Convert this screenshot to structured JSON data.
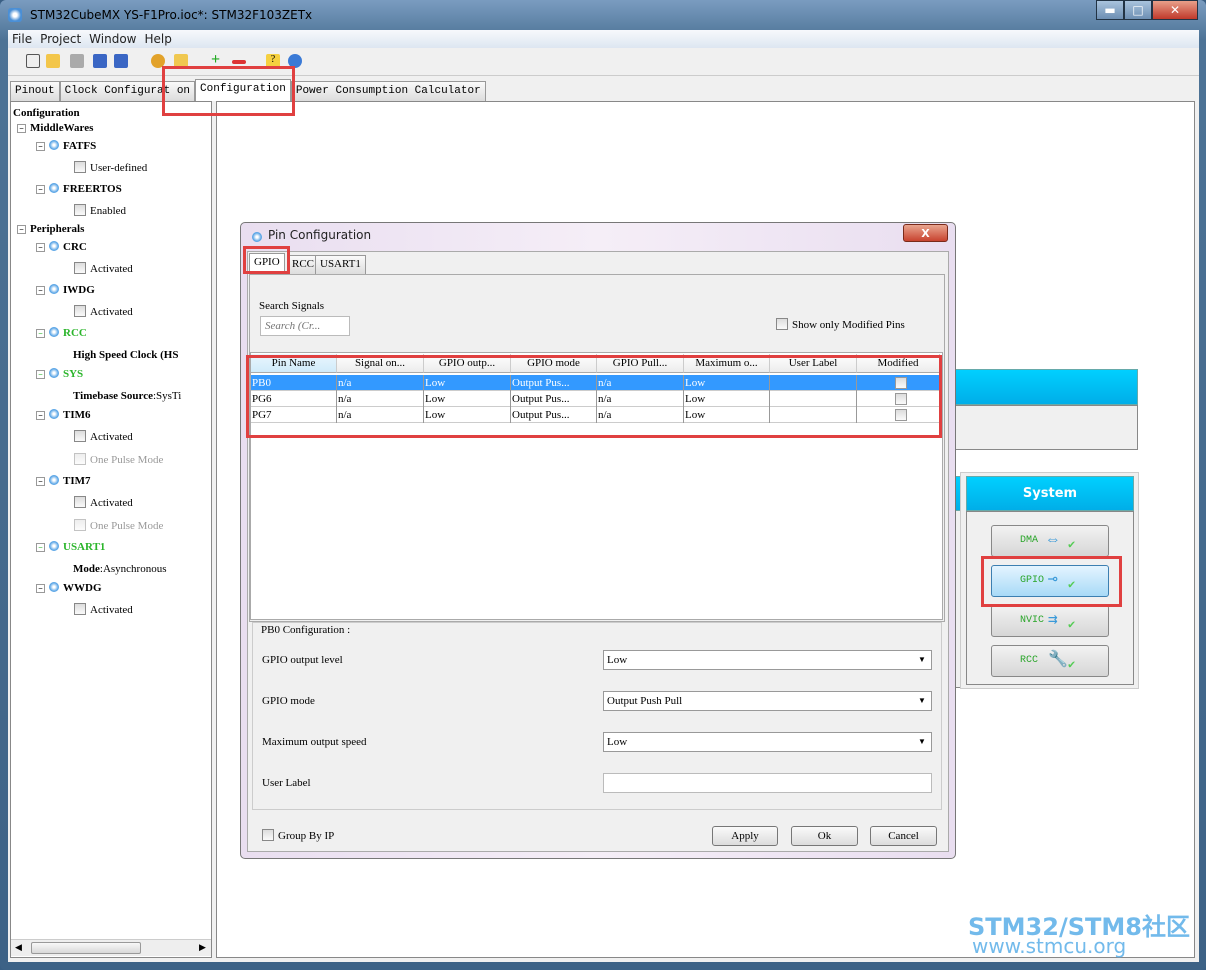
{
  "window": {
    "title": "STM32CubeMX YS-F1Pro.ioc*: STM32F103ZETx",
    "minimize": "▬",
    "maximize": "□",
    "close": "✕"
  },
  "menu": [
    "File",
    "Project",
    "Window",
    "Help"
  ],
  "tabs": [
    {
      "label": "Pinout"
    },
    {
      "label": "Clock Configurat on"
    },
    {
      "label": "Configuration",
      "active": true
    },
    {
      "label": "Power Consumption Calculator"
    }
  ],
  "tree": {
    "root": "Configuration",
    "middlewares": "MiddleWares",
    "fatfs": "FATFS",
    "fatfs_opt": "User-defined",
    "freertos": "FREERTOS",
    "freertos_opt": "Enabled",
    "peripherals": "Peripherals",
    "crc": "CRC",
    "crc_opt": "Activated",
    "iwdg": "IWDG",
    "iwdg_opt": "Activated",
    "rcc": "RCC",
    "rcc_opt": "High Speed Clock (HS",
    "sys": "SYS",
    "sys_key": "Timebase Source",
    "sys_val": ":SysTi",
    "tim6": "TIM6",
    "tim6_opt": "Activated",
    "tim6_opt2": "One Pulse Mode",
    "tim7": "TIM7",
    "tim7_opt": "Activated",
    "tim7_opt2": "One Pulse Mode",
    "usart1": "USART1",
    "usart1_key": "Mode",
    "usart1_val": ":Asynchronous",
    "wwdg": "WWDG",
    "wwdg_opt": "Activated"
  },
  "system_panel": {
    "title": "System",
    "buttons": [
      {
        "label": "DMA"
      },
      {
        "label": "GPIO",
        "selected": true
      },
      {
        "label": "NVIC"
      },
      {
        "label": "RCC"
      }
    ]
  },
  "dialog": {
    "title": "Pin Configuration",
    "close": "X",
    "tabs": [
      {
        "label": "GPIO"
      },
      {
        "label": "RCC"
      },
      {
        "label": "USART1"
      }
    ],
    "search_label": "Search Signals",
    "search_placeholder": "Search (Cr...",
    "show_modified": "Show only Modified Pins",
    "columns": [
      "Pin Name",
      "Signal on...",
      "GPIO outp...",
      "GPIO mode",
      "GPIO Pull...",
      "Maximum o...",
      "User Label",
      "Modified"
    ],
    "rows": [
      [
        "PB0",
        "n/a",
        "Low",
        "Output Pus...",
        "n/a",
        "Low",
        ""
      ],
      [
        "PG6",
        "n/a",
        "Low",
        "Output Pus...",
        "n/a",
        "Low",
        ""
      ],
      [
        "PG7",
        "n/a",
        "Low",
        "Output Pus...",
        "n/a",
        "Low",
        ""
      ]
    ],
    "selected_row": 0,
    "config_title": "PB0 Configuration :",
    "fields": [
      {
        "label": "GPIO output level",
        "value": "Low"
      },
      {
        "label": "GPIO mode",
        "value": "Output Push Pull"
      },
      {
        "label": "Maximum output speed",
        "value": "Low"
      },
      {
        "label": "User Label",
        "value": ""
      }
    ],
    "group_by_ip": "Group By IP",
    "apply": "Apply",
    "ok": "Ok",
    "cancel": "Cancel"
  },
  "watermark": {
    "line1": "STM32/STM8社区",
    "line2": "www.stmcu.org"
  },
  "colors": {
    "accent": "#00b8f0",
    "highlight": "#e04040",
    "selection": "#3399ff",
    "active_peripheral": "#2bb52b"
  }
}
